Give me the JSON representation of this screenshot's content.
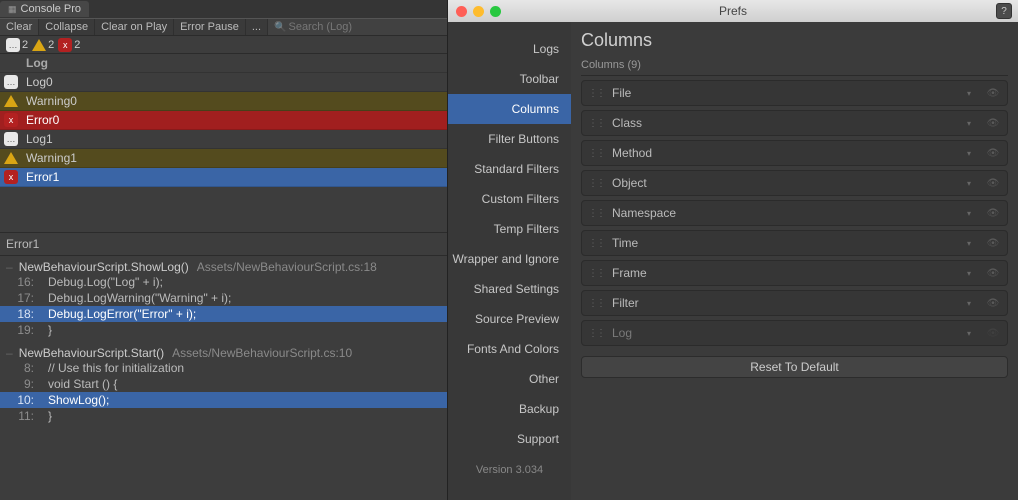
{
  "console": {
    "tab_title": "Console Pro",
    "toolbar": {
      "clear": "Clear",
      "collapse": "Collapse",
      "clear_on_play": "Clear on Play",
      "error_pause": "Error Pause",
      "dots": "...",
      "search_placeholder": "Search (Log)"
    },
    "counts": {
      "log": "2",
      "warn": "2",
      "err": "2"
    },
    "header_label": "Log",
    "rows": [
      {
        "kind": "log",
        "label": "Log0",
        "bg": ""
      },
      {
        "kind": "warn",
        "label": "Warning0",
        "bg": "warn-bg"
      },
      {
        "kind": "err",
        "label": "Error0",
        "bg": "err-bg"
      },
      {
        "kind": "log",
        "label": "Log1",
        "bg": ""
      },
      {
        "kind": "warn",
        "label": "Warning1",
        "bg": "warn-bg"
      },
      {
        "kind": "err",
        "label": "Error1",
        "bg": "sel"
      }
    ],
    "detail": {
      "title": "Error1",
      "frames": [
        {
          "method": "NewBehaviourScript.ShowLog()",
          "path": "Assets/NewBehaviourScript.cs:18",
          "lines": [
            {
              "n": "16:",
              "code": "Debug.Log(\"Log\" + i);"
            },
            {
              "n": "17:",
              "code": "Debug.LogWarning(\"Warning\" + i);"
            },
            {
              "n": "18:",
              "code": "Debug.LogError(\"Error\" + i);",
              "sel": true
            },
            {
              "n": "19:",
              "code": "}"
            }
          ]
        },
        {
          "method": "NewBehaviourScript.Start()",
          "path": "Assets/NewBehaviourScript.cs:10",
          "lines": [
            {
              "n": "8:",
              "code": "// Use this for initialization"
            },
            {
              "n": "9:",
              "code": "void Start () {"
            },
            {
              "n": "10:",
              "code": "    ShowLog();",
              "sel": true
            },
            {
              "n": "11:",
              "code": "}"
            }
          ]
        }
      ]
    }
  },
  "prefs": {
    "window_title": "Prefs",
    "help": "?",
    "sidebar": [
      "Logs",
      "Toolbar",
      "Columns",
      "Filter Buttons",
      "Standard Filters",
      "Custom Filters",
      "Temp Filters",
      "Wrapper and Ignore",
      "Shared Settings",
      "Source Preview",
      "Fonts And Colors",
      "Other",
      "Backup",
      "Support"
    ],
    "selected_index": 2,
    "version": "Version 3.034",
    "main": {
      "title": "Columns",
      "subhead": "Columns (9)",
      "columns": [
        {
          "name": "File",
          "enabled": true
        },
        {
          "name": "Class",
          "enabled": true
        },
        {
          "name": "Method",
          "enabled": true
        },
        {
          "name": "Object",
          "enabled": true
        },
        {
          "name": "Namespace",
          "enabled": true
        },
        {
          "name": "Time",
          "enabled": true
        },
        {
          "name": "Frame",
          "enabled": true
        },
        {
          "name": "Filter",
          "enabled": true
        },
        {
          "name": "Log",
          "enabled": false
        }
      ],
      "reset": "Reset To Default"
    }
  }
}
